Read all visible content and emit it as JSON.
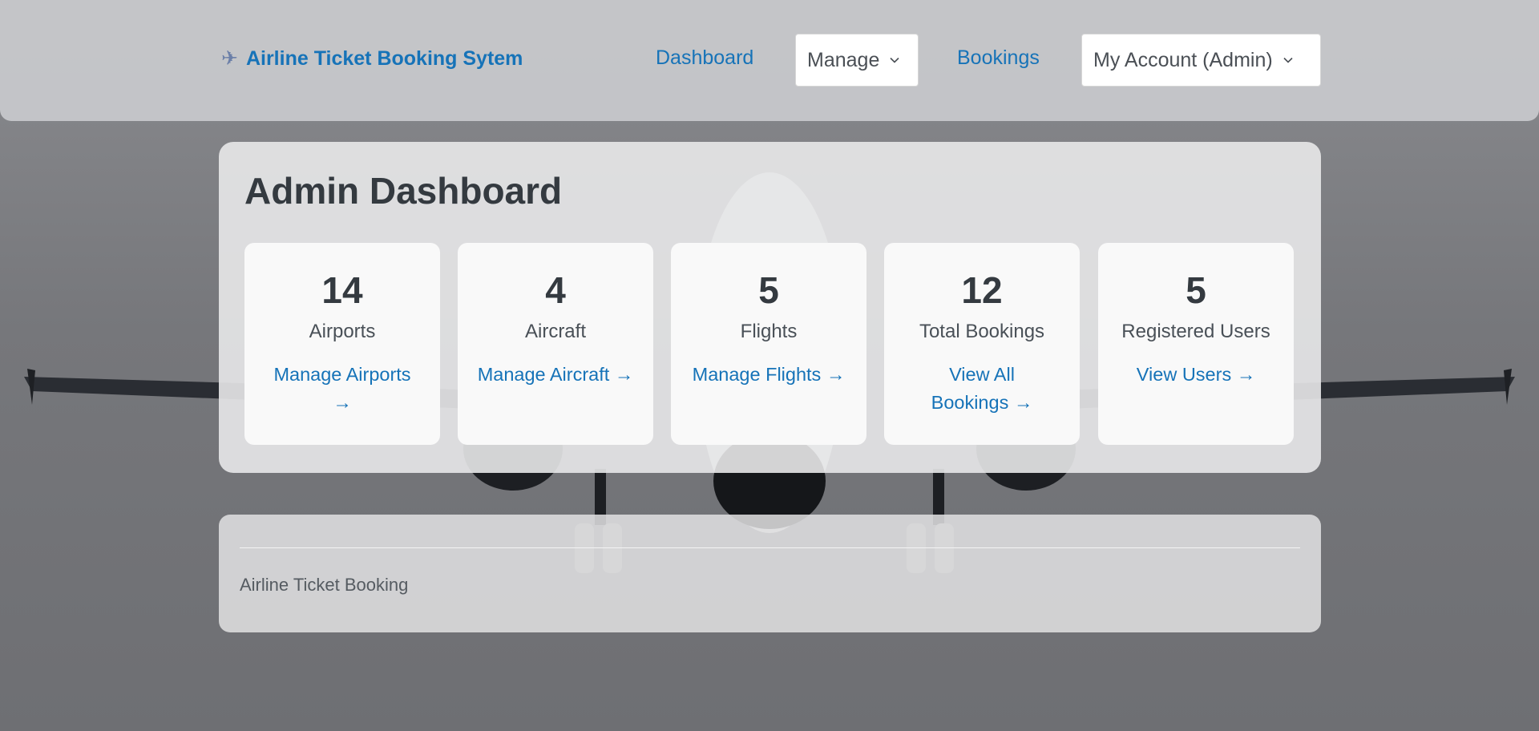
{
  "brand": {
    "icon": "airplane-icon",
    "name": "Airline Ticket Booking Sytem"
  },
  "nav": {
    "dashboard": "Dashboard",
    "manage": "Manage",
    "bookings": "Bookings",
    "account": "My Account (Admin)"
  },
  "page": {
    "title": "Admin Dashboard"
  },
  "stats": [
    {
      "value": "14",
      "label": "Airports",
      "link": "Manage Airports →"
    },
    {
      "value": "4",
      "label": "Aircraft",
      "link": "Manage Aircraft →"
    },
    {
      "value": "5",
      "label": "Flights",
      "link": "Manage Flights →"
    },
    {
      "value": "12",
      "label": "Total Bookings",
      "link": "View All Bookings →"
    },
    {
      "value": "5",
      "label": "Registered Users",
      "link": "View Users →"
    }
  ],
  "footer": {
    "text": "Airline Ticket Booking"
  },
  "colors": {
    "link": "#1673b8",
    "heading": "#343a40"
  }
}
